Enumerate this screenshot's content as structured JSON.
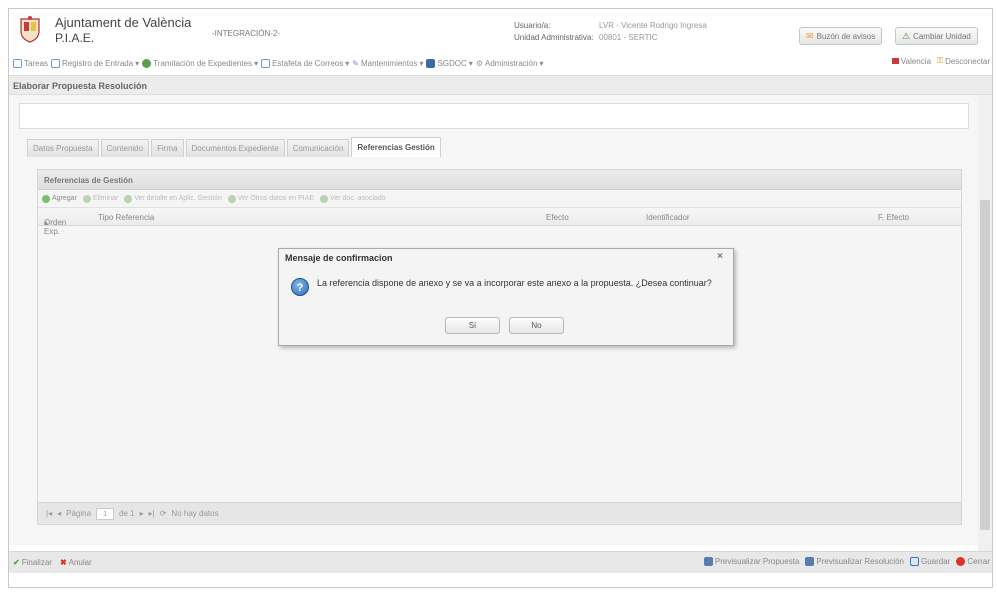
{
  "header": {
    "org_name": "Ajuntament de València",
    "app_name": "P.I.A.E.",
    "environment": "-INTEGRACIÓN-2-",
    "user_label": "Usuario/a:",
    "user_value": "LVR - Vicente Rodrigo Ingresa",
    "unit_label": "Unidad Administrativa:",
    "unit_value": "00801 - SERTIC",
    "buzon_label": "Buzón de avisos",
    "cambiar_unidad_label": "Cambiar Unidad"
  },
  "menu": {
    "items": [
      {
        "label": "Tareas"
      },
      {
        "label": "Registro de Entrada"
      },
      {
        "label": "Tramitación de Expedientes"
      },
      {
        "label": "Estafeta de Correos"
      },
      {
        "label": "Mantenimientos"
      },
      {
        "label": "SGDOC"
      },
      {
        "label": "Administración"
      }
    ],
    "city_label": "Valencia",
    "logout_label": "Desconectar"
  },
  "panel": {
    "title": "Elaborar Propuesta Resolución"
  },
  "tabs": [
    {
      "label": "Datos Propuesta"
    },
    {
      "label": "Contenido"
    },
    {
      "label": "Firma"
    },
    {
      "label": "Documentos Expediente"
    },
    {
      "label": "Comunicación"
    },
    {
      "label": "Referencias Gestión"
    }
  ],
  "references": {
    "title": "Referencias de Gestión",
    "tools": {
      "add": "Agregar",
      "delete": "Eliminar",
      "detail": "Ver detalle en Aplic. Gestión",
      "other": "Ver Otros datos en PIAE",
      "doc": "Ver doc. asociado"
    },
    "columns": {
      "orden": "Orden Exp.",
      "tipo": "Tipo Referencia",
      "efecto": "Efecto",
      "identificador": "Identificador",
      "f_efecto": "F. Efecto"
    },
    "pager": {
      "page_label": "Página",
      "page_value": "1",
      "of_label": "de 1",
      "no_data": "No hay datos"
    }
  },
  "bottom": {
    "finalizar": "Finalizar",
    "anular": "Anular",
    "previsualizar_propuesta": "Previsualizar Propuesta",
    "previsualizar_resolucion": "Previsualizar Resolución",
    "guardar": "Guardar",
    "cerrar": "Cerrar"
  },
  "dialog": {
    "title": "Mensaje de confirmacion",
    "message": "La referencia dispone de anexo y se va a incorporar este anexo a la propuesta. ¿Desea continuar?",
    "yes": "Sí",
    "no": "No"
  },
  "colors": {
    "accent_blue": "#2d6fb8",
    "cancel_red": "#d9342b",
    "ok_green": "#4ea83c"
  }
}
